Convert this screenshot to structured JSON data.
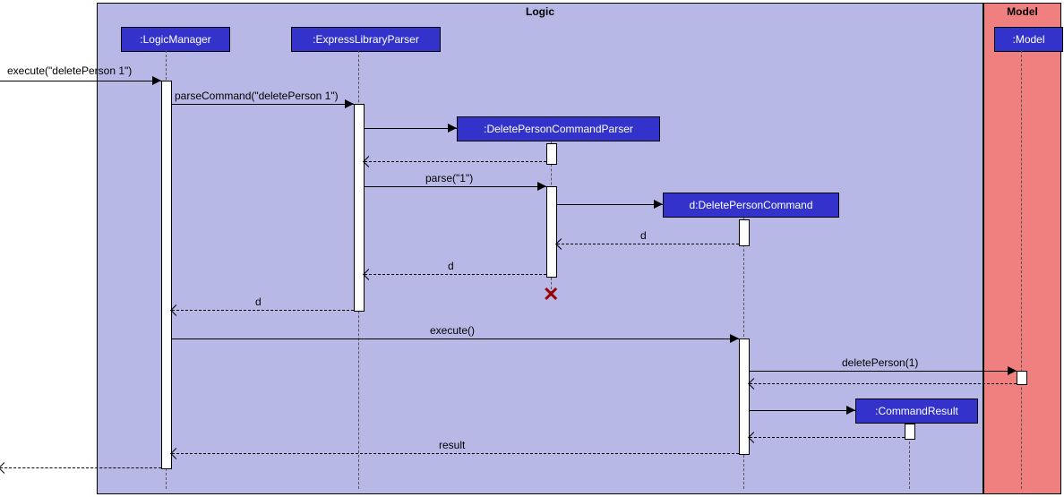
{
  "frames": {
    "logic": "Logic",
    "model": "Model"
  },
  "participants": {
    "logicManager": ":LogicManager",
    "expressLibraryParser": ":ExpressLibraryParser",
    "deletePersonCommandParser": ":DeletePersonCommandParser",
    "deletePersonCommand": "d:DeletePersonCommand",
    "commandResult": ":CommandResult",
    "model": ":Model"
  },
  "messages": {
    "m1": "execute(\"deletePerson 1\")",
    "m2": "parseCommand(\"deletePerson 1\")",
    "m3_ret": "",
    "m4": "parse(\"1\")",
    "m5_ret": "d",
    "m6_ret": "d",
    "m7_ret": "d",
    "m8": "execute()",
    "m9": "deletePerson(1)",
    "m10_ret": "",
    "m11_create": "",
    "m12_ret": "",
    "m13_ret": "result",
    "m14_ret": ""
  },
  "chart_data": {
    "type": "sequence-diagram",
    "frames": [
      {
        "name": "Logic",
        "contains": [
          "LogicManager",
          "ExpressLibraryParser",
          "DeletePersonCommandParser",
          "DeletePersonCommand",
          "CommandResult"
        ]
      },
      {
        "name": "Model",
        "contains": [
          "Model"
        ]
      }
    ],
    "participants": [
      {
        "id": "actor",
        "label": "",
        "external": true
      },
      {
        "id": "LogicManager",
        "label": ":LogicManager"
      },
      {
        "id": "ExpressLibraryParser",
        "label": ":ExpressLibraryParser"
      },
      {
        "id": "DeletePersonCommandParser",
        "label": ":DeletePersonCommandParser",
        "created_by_msg": 2
      },
      {
        "id": "DeletePersonCommand",
        "label": "d:DeletePersonCommand",
        "created_by_msg": 5
      },
      {
        "id": "CommandResult",
        "label": ":CommandResult",
        "created_by_msg": 11
      },
      {
        "id": "Model",
        "label": ":Model"
      }
    ],
    "messages": [
      {
        "n": 1,
        "from": "actor",
        "to": "LogicManager",
        "label": "execute(\"deletePerson 1\")",
        "type": "sync"
      },
      {
        "n": 2,
        "from": "LogicManager",
        "to": "ExpressLibraryParser",
        "label": "parseCommand(\"deletePerson 1\")",
        "type": "sync"
      },
      {
        "n": 3,
        "from": "ExpressLibraryParser",
        "to": "DeletePersonCommandParser",
        "label": "",
        "type": "create"
      },
      {
        "n": 4,
        "from": "DeletePersonCommandParser",
        "to": "ExpressLibraryParser",
        "label": "",
        "type": "return"
      },
      {
        "n": 5,
        "from": "ExpressLibraryParser",
        "to": "DeletePersonCommandParser",
        "label": "parse(\"1\")",
        "type": "sync"
      },
      {
        "n": 6,
        "from": "DeletePersonCommandParser",
        "to": "DeletePersonCommand",
        "label": "",
        "type": "create"
      },
      {
        "n": 7,
        "from": "DeletePersonCommand",
        "to": "DeletePersonCommandParser",
        "label": "d",
        "type": "return"
      },
      {
        "n": 8,
        "from": "DeletePersonCommandParser",
        "to": "ExpressLibraryParser",
        "label": "d",
        "type": "return"
      },
      {
        "n": 9,
        "note": "destroy",
        "target": "DeletePersonCommandParser"
      },
      {
        "n": 10,
        "from": "ExpressLibraryParser",
        "to": "LogicManager",
        "label": "d",
        "type": "return"
      },
      {
        "n": 11,
        "from": "LogicManager",
        "to": "DeletePersonCommand",
        "label": "execute()",
        "type": "sync"
      },
      {
        "n": 12,
        "from": "DeletePersonCommand",
        "to": "Model",
        "label": "deletePerson(1)",
        "type": "sync"
      },
      {
        "n": 13,
        "from": "Model",
        "to": "DeletePersonCommand",
        "label": "",
        "type": "return"
      },
      {
        "n": 14,
        "from": "DeletePersonCommand",
        "to": "CommandResult",
        "label": "",
        "type": "create"
      },
      {
        "n": 15,
        "from": "CommandResult",
        "to": "DeletePersonCommand",
        "label": "",
        "type": "return"
      },
      {
        "n": 16,
        "from": "DeletePersonCommand",
        "to": "LogicManager",
        "label": "result",
        "type": "return"
      },
      {
        "n": 17,
        "from": "LogicManager",
        "to": "actor",
        "label": "",
        "type": "return"
      }
    ]
  }
}
